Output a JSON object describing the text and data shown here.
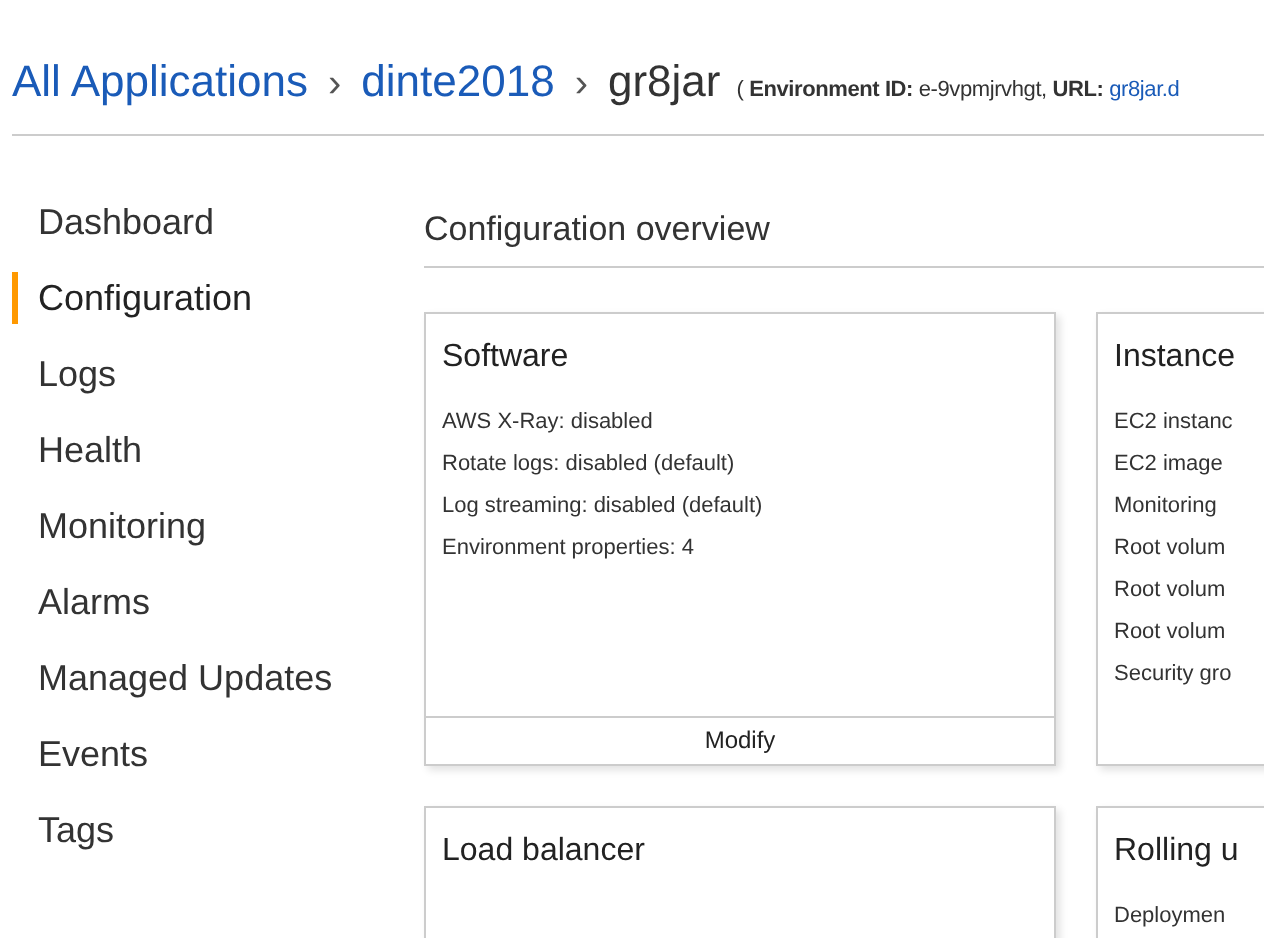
{
  "breadcrumb": [
    {
      "label": "All Applications",
      "kind": "link"
    },
    {
      "label": "dinte2018",
      "kind": "link"
    },
    {
      "label": "gr8jar",
      "kind": "current"
    }
  ],
  "separator": "›",
  "environment_info": {
    "open": "(",
    "id_label": "Environment ID:",
    "id_value": "e-9vpmjrvhgt,",
    "url_label": "URL:",
    "url_value": "gr8jar.d"
  },
  "sidebar": {
    "items": [
      {
        "label": "Dashboard",
        "selected": false
      },
      {
        "label": "Configuration",
        "selected": true
      },
      {
        "label": "Logs",
        "selected": false
      },
      {
        "label": "Health",
        "selected": false
      },
      {
        "label": "Monitoring",
        "selected": false
      },
      {
        "label": "Alarms",
        "selected": false
      },
      {
        "label": "Managed Updates",
        "selected": false
      },
      {
        "label": "Events",
        "selected": false
      },
      {
        "label": "Tags",
        "selected": false
      }
    ]
  },
  "main": {
    "title": "Configuration overview",
    "cards": [
      {
        "title": "Software",
        "lines": [
          "AWS X-Ray: disabled",
          "Rotate logs: disabled (default)",
          "Log streaming: disabled (default)",
          "Environment properties: 4"
        ],
        "action": "Modify"
      },
      {
        "title": "Instance",
        "lines": [
          "EC2 instanc",
          "EC2 image",
          "Monitoring",
          "Root volum",
          "Root volum",
          "Root volum",
          "Security gro"
        ]
      },
      {
        "title": "Load balancer"
      },
      {
        "title": "Rolling u",
        "lines": [
          "Deploymen"
        ]
      }
    ]
  }
}
